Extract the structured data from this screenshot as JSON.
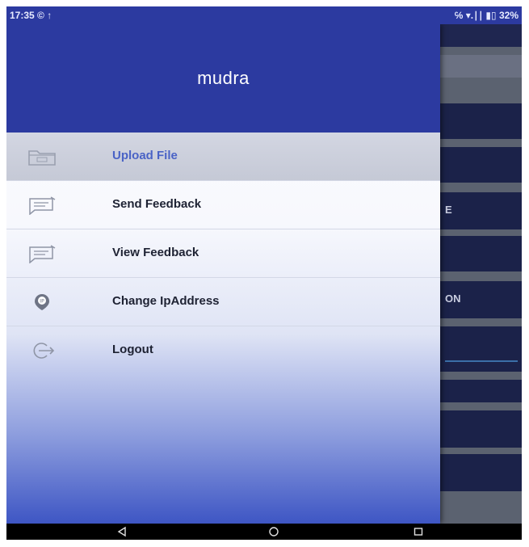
{
  "status_bar": {
    "time": "17:35 © ↑",
    "indicators": "℅ ▾.∣∣ ▮▯ 32%"
  },
  "drawer": {
    "app_title": "mudra",
    "items": [
      {
        "label": "Upload File",
        "icon": "folder-icon",
        "selected": true
      },
      {
        "label": "Send Feedback",
        "icon": "chat-feedback-icon",
        "selected": false
      },
      {
        "label": "View Feedback",
        "icon": "chat-feedback-icon",
        "selected": false
      },
      {
        "label": "Change IpAddress",
        "icon": "ip-location-icon",
        "selected": false
      },
      {
        "label": "Logout",
        "icon": "logout-icon",
        "selected": false
      }
    ]
  },
  "background_app": {
    "partial_labels": [
      "E",
      "ON"
    ]
  },
  "colors": {
    "header": "#2c3aa0",
    "selected_text": "#4a63c6",
    "item_text": "#1e2233"
  }
}
